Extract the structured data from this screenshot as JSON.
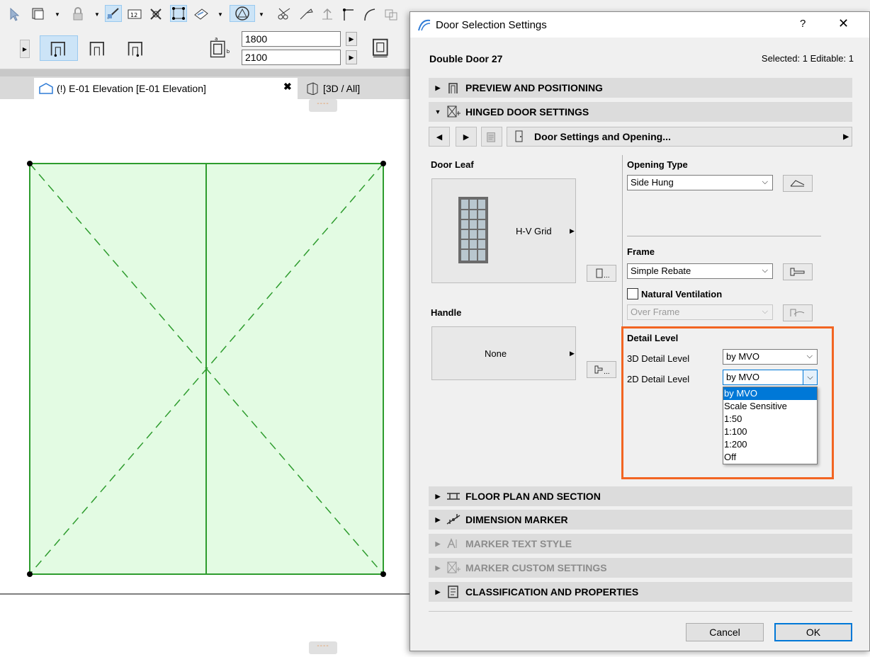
{
  "toolbar": {
    "width_value": "1800",
    "height_value": "2100"
  },
  "tabs": [
    {
      "label": "(!) E-01 Elevation [E-01 Elevation]"
    },
    {
      "label": "[3D / All]"
    }
  ],
  "dialog": {
    "title": "Door Selection Settings",
    "help": "?",
    "close": "✕",
    "object_name": "Double Door 27",
    "selection_info": "Selected: 1 Editable: 1",
    "sections": {
      "preview": "PREVIEW AND POSITIONING",
      "hinged": "HINGED DOOR SETTINGS",
      "floor_plan": "FLOOR PLAN AND SECTION",
      "dimension": "DIMENSION MARKER",
      "marker_text": "MARKER TEXT STYLE",
      "marker_custom": "MARKER CUSTOM SETTINGS",
      "classification": "CLASSIFICATION AND PROPERTIES"
    },
    "page_selector": "Door Settings and Opening...",
    "door_leaf": {
      "label": "Door Leaf",
      "value": "H-V Grid"
    },
    "handle": {
      "label": "Handle",
      "value": "None"
    },
    "more_button": "...",
    "opening_type": {
      "label": "Opening Type",
      "value": "Side Hung"
    },
    "frame": {
      "label": "Frame",
      "value": "Simple Rebate"
    },
    "natural_ventilation": {
      "label": "Natural Ventilation",
      "value": "Over Frame",
      "checked": false
    },
    "detail_level": {
      "label": "Detail Level",
      "detail_3d_label": "3D Detail Level",
      "detail_3d_value": "by MVO",
      "detail_2d_label": "2D Detail Level",
      "detail_2d_value": "by MVO",
      "options": [
        "by MVO",
        "Scale Sensitive",
        "1:50",
        "1:100",
        "1:200",
        "Off"
      ]
    },
    "buttons": {
      "cancel": "Cancel",
      "ok": "OK"
    }
  },
  "colors": {
    "door_fill": "#e3fbe3",
    "door_stroke": "#2e9c2e",
    "highlight": "#f26522",
    "selection": "#0078d7"
  }
}
